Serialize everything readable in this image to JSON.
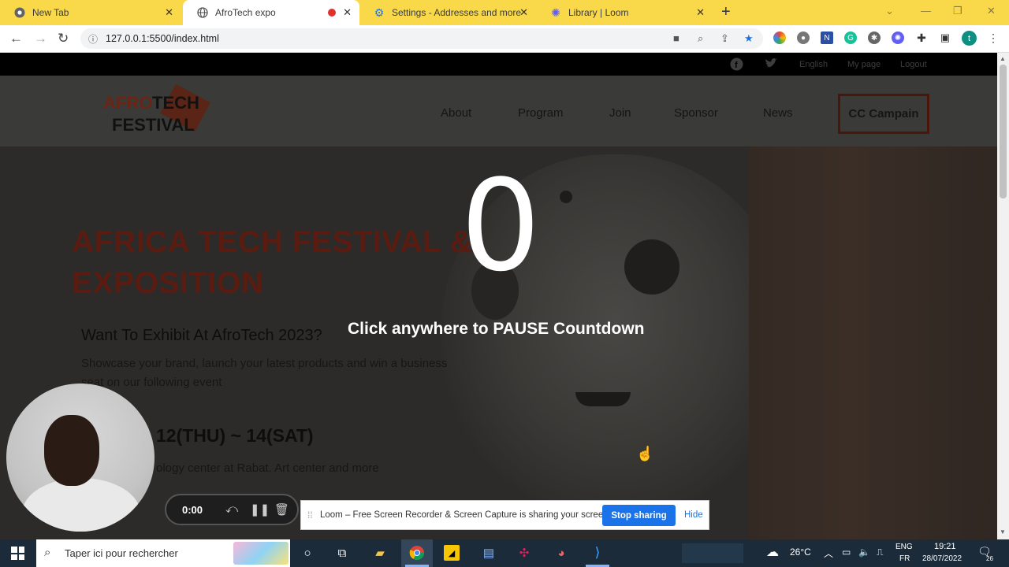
{
  "browser": {
    "tabs": [
      {
        "title": "New Tab",
        "icon": "chrome-icon"
      },
      {
        "title": "AfroTech expo",
        "icon": "globe-icon"
      },
      {
        "title": "Settings - Addresses and more",
        "icon": "gear-icon"
      },
      {
        "title": "Library | Loom",
        "icon": "loom-icon"
      }
    ],
    "url": "127.0.0.1:5500/index.html"
  },
  "site": {
    "topbar": {
      "english": "English",
      "mypage": "My page",
      "logout": "Logout"
    },
    "logo": {
      "part1": "AFRO",
      "part2": "TECH",
      "part3": "FESTIVAL"
    },
    "nav": [
      "About",
      "Program",
      "Join",
      "Sponsor",
      "News"
    ],
    "campaign": "CC Campain",
    "hero": {
      "title_line1": "AFRICA TECH FESTIVAL &",
      "title_line2": "EXPOSITION",
      "exhibit_heading": "Want To Exhibit At AfroTech 2023?",
      "desc_line1": "Showcase your brand, launch your latest products and win a business",
      "desc_line2": "seat on our following event",
      "date": "12(THU) ~ 14(SAT)",
      "location": "ology center at Rabat. Art center and more"
    },
    "countdown": {
      "value": "0",
      "hint": "Click anywhere to PAUSE Countdown"
    }
  },
  "loom": {
    "timer": "0:00",
    "share_message": "Loom – Free Screen Recorder & Screen Capture is sharing your screen.",
    "stop_label": "Stop sharing",
    "hide_label": "Hide"
  },
  "taskbar": {
    "search_placeholder": "Taper ici pour rechercher",
    "temperature": "26°C",
    "lang_top": "ENG",
    "lang_bottom": "FR",
    "time": "19:21",
    "date": "28/07/2022",
    "notifications": "26"
  }
}
